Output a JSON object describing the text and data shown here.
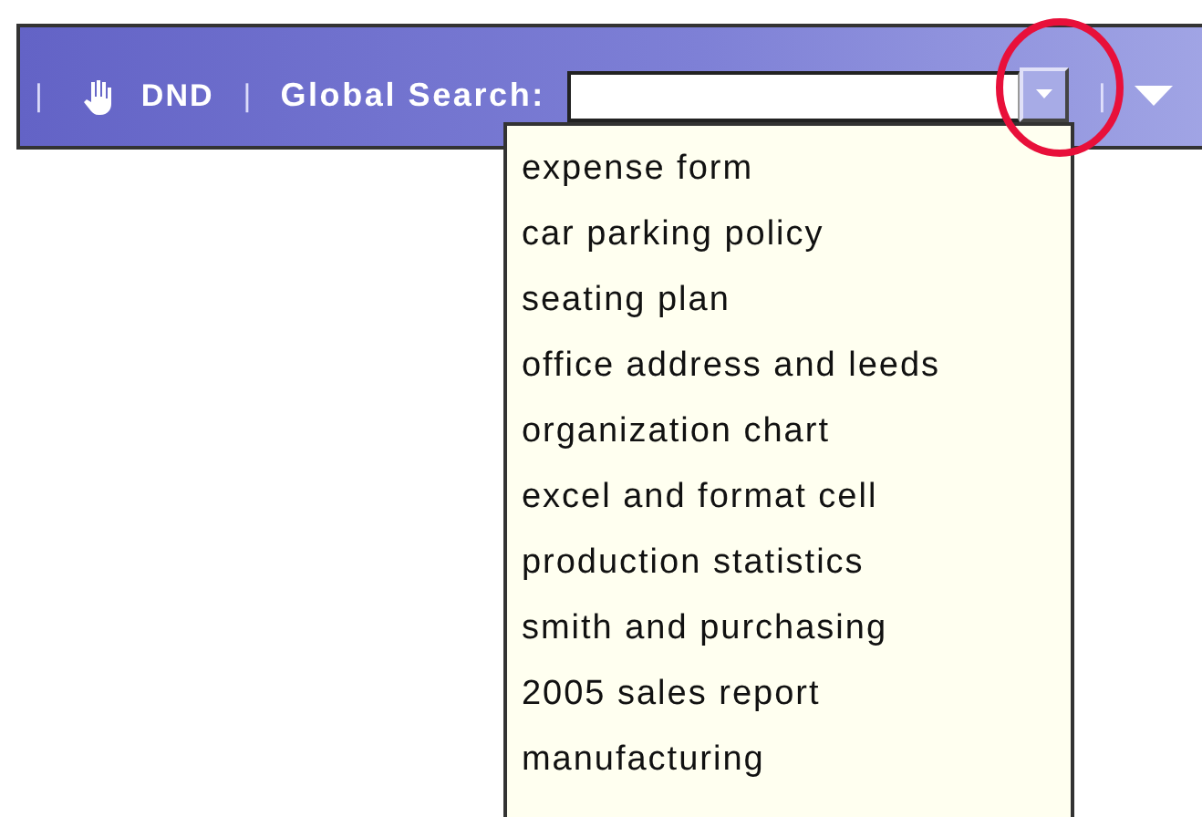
{
  "toolbar": {
    "items": [
      {
        "kind": "separator",
        "text": "|"
      },
      {
        "kind": "button",
        "text": "DND"
      },
      {
        "kind": "separator",
        "text": "|"
      },
      {
        "kind": "label",
        "text": "Global Search:"
      },
      {
        "kind": "search",
        "expanded": true,
        "suggestions": [
          "expense form",
          "car parking policy",
          "seating plan",
          "office address and leeds",
          "organization chart",
          "excel and format cell",
          "production statistics",
          "smith and purchasing",
          "2005 sales report",
          "manufacturing"
        ]
      },
      {
        "kind": "separator",
        "text": "|"
      },
      {
        "kind": "menu"
      }
    ]
  }
}
